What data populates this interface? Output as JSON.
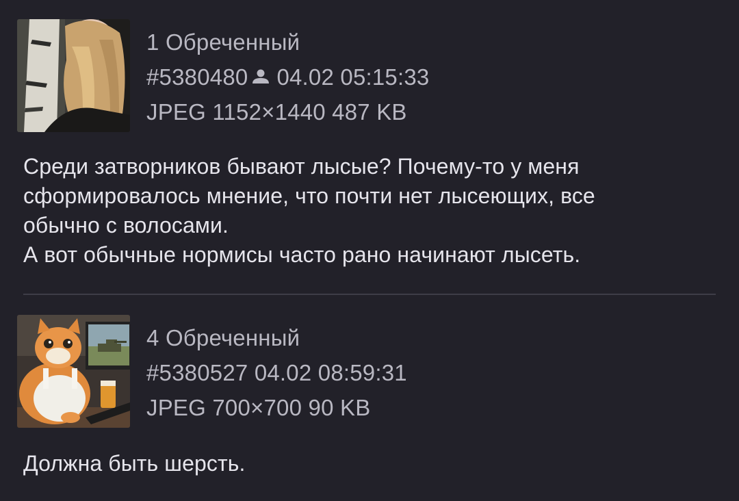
{
  "posts": [
    {
      "number": "1",
      "author": "Обреченный",
      "post_id": "#5380480",
      "datetime": "04.02 05:15:33",
      "file_info": "JPEG 1152×1440 487 KB",
      "thumbnail_icon": "girl-birch-photo",
      "text_lines": [
        "Среди затворников бывают лысые? Почему-то у меня",
        "сформировалось мнение, что почти нет лысеющих, все",
        "обычно с волосами.",
        "А вот обычные нормисы часто рано начинают лысеть."
      ]
    },
    {
      "number": "4",
      "author": "Обреченный",
      "post_id": "#5380527",
      "datetime": "04.02 08:59:31",
      "file_info": "JPEG 700×700 90 KB",
      "thumbnail_icon": "cat-gamer-photo",
      "text_lines": [
        "Должна быть шерсть."
      ]
    }
  ],
  "colors": {
    "background": "#222129",
    "meta_text": "#b9b8c2",
    "body_text": "#e6e5ec",
    "divider": "#3e3d47"
  }
}
